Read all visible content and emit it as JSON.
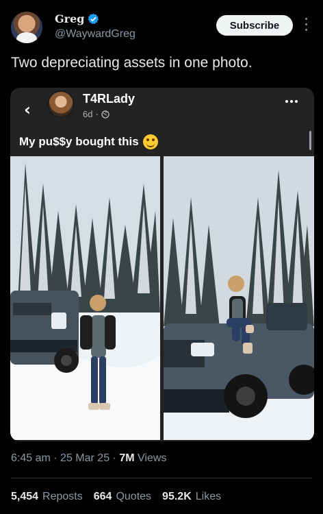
{
  "author": {
    "name": "Greg",
    "handle": "@WaywardGreg",
    "subscribe_label": "Subscribe"
  },
  "tweet": {
    "text": "Two depreciating assets in one photo.",
    "time": "6:45 am",
    "date": "25 Mar 25",
    "views_count": "7M",
    "views_label": "Views",
    "separator": "·"
  },
  "embed": {
    "name": "T4RLady",
    "age": "6d",
    "dot": "·",
    "caption": "My pu$$y bought this"
  },
  "stats": {
    "reposts_count": "5,454",
    "reposts_label": "Reposts",
    "quotes_count": "664",
    "quotes_label": "Quotes",
    "likes_count": "95.2K",
    "likes_label": "Likes"
  },
  "icons": {
    "verified": "verified-badge-icon",
    "more": "more-vertical-icon",
    "back": "chevron-left-icon",
    "globe": "globe-icon",
    "dots": "more-horizontal-icon",
    "emoji": "smiling-face-emoji"
  },
  "colors": {
    "background": "#000000",
    "accent": "#1d9bf0",
    "muted": "#8b98a5",
    "card": "#232323"
  }
}
